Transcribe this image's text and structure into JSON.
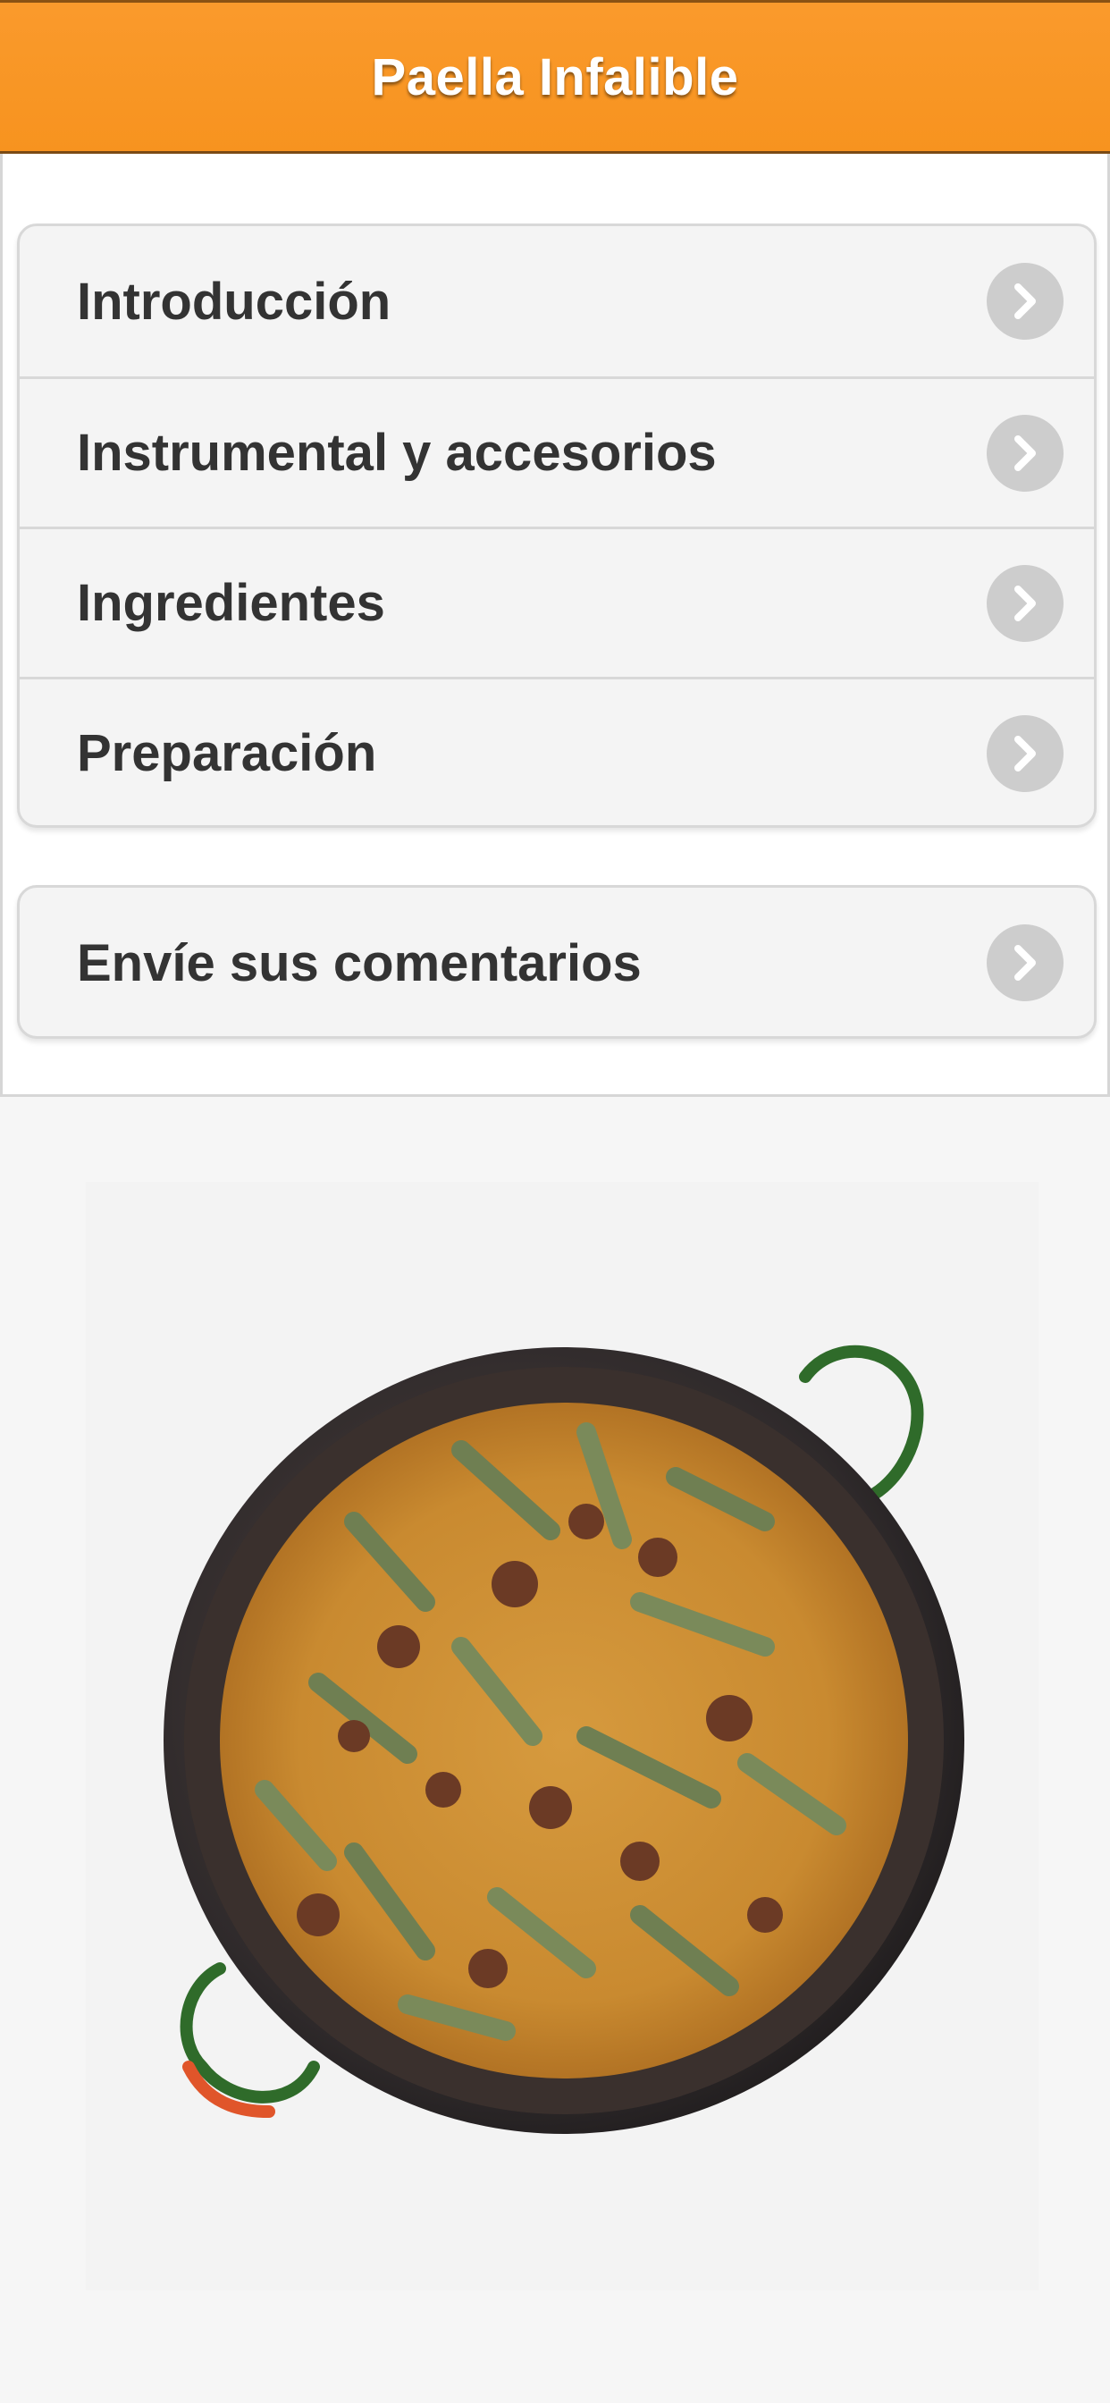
{
  "header": {
    "title": "Paella Infalible"
  },
  "menu": {
    "items": [
      {
        "label": "Introducción"
      },
      {
        "label": "Instrumental y accesorios"
      },
      {
        "label": "Ingredientes"
      },
      {
        "label": "Preparación"
      }
    ],
    "feedback": {
      "label": "Envíe sus comentarios"
    }
  },
  "icons": {
    "chevron": "chevron-right-icon",
    "image": "paella-pan"
  },
  "colors": {
    "header_bg": "#f7931f",
    "header_text": "#ffffff",
    "row_bg": "#f4f4f4",
    "label_text": "#333333",
    "chevron_circle": "#cdcdcd"
  }
}
